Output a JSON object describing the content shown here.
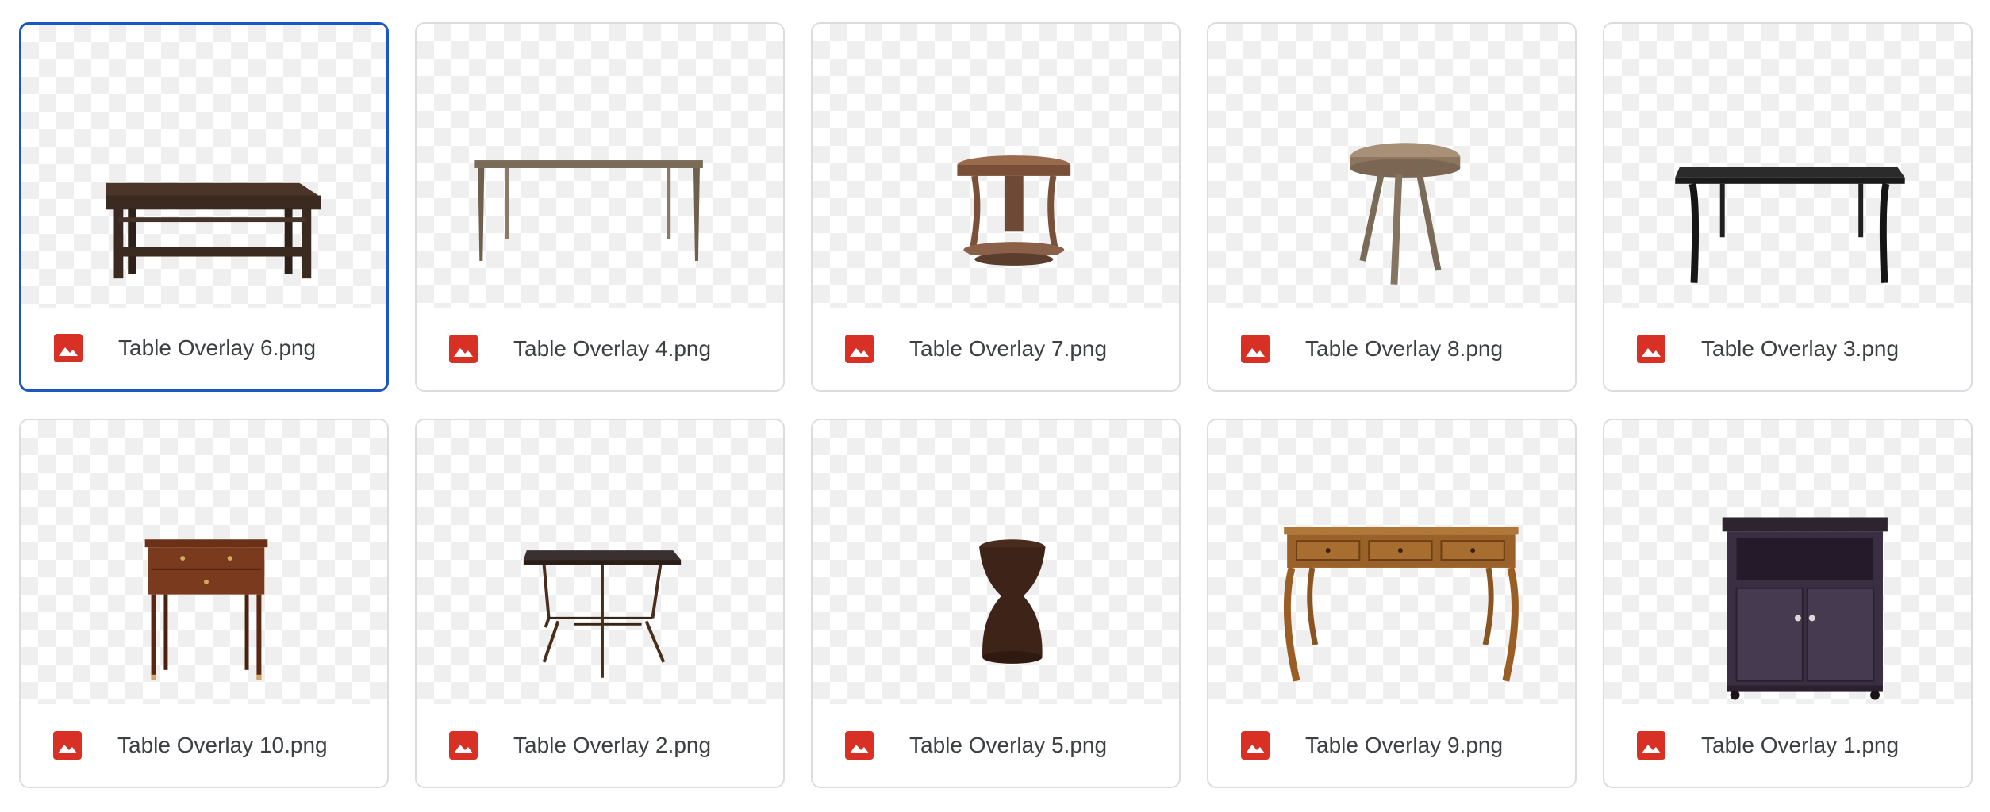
{
  "files": [
    {
      "name": "Table Overlay 6.png",
      "selected": true,
      "icon": "image-file-icon",
      "thumb": "coffee-table"
    },
    {
      "name": "Table Overlay 4.png",
      "selected": false,
      "icon": "image-file-icon",
      "thumb": "long-table"
    },
    {
      "name": "Table Overlay 7.png",
      "selected": false,
      "icon": "image-file-icon",
      "thumb": "pedestal-table"
    },
    {
      "name": "Table Overlay 8.png",
      "selected": false,
      "icon": "image-file-icon",
      "thumb": "stool"
    },
    {
      "name": "Table Overlay 3.png",
      "selected": false,
      "icon": "image-file-icon",
      "thumb": "black-table"
    },
    {
      "name": "Table Overlay 10.png",
      "selected": false,
      "icon": "image-file-icon",
      "thumb": "side-table"
    },
    {
      "name": "Table Overlay 2.png",
      "selected": false,
      "icon": "image-file-icon",
      "thumb": "bistro-table"
    },
    {
      "name": "Table Overlay 5.png",
      "selected": false,
      "icon": "image-file-icon",
      "thumb": "drum-stool"
    },
    {
      "name": "Table Overlay 9.png",
      "selected": false,
      "icon": "image-file-icon",
      "thumb": "writing-desk"
    },
    {
      "name": "Table Overlay 1.png",
      "selected": false,
      "icon": "image-file-icon",
      "thumb": "cabinet"
    }
  ],
  "colors": {
    "selected_border": "#1a57c4",
    "card_border": "#dadce0",
    "icon_red": "#d93025",
    "text": "#3c4043"
  }
}
